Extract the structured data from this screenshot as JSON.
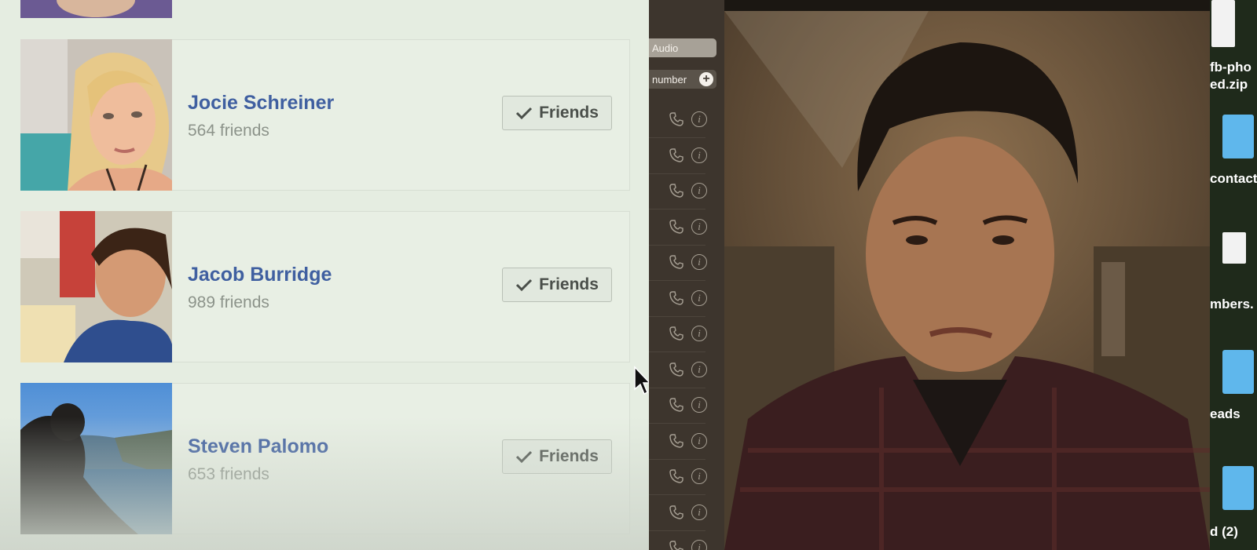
{
  "friends": [
    {
      "name": "Jocie Schreiner",
      "count": "564 friends",
      "button": "Friends"
    },
    {
      "name": "Jacob Burridge",
      "count": "989 friends",
      "button": "Friends"
    },
    {
      "name": "Steven Palomo",
      "count": "653 friends",
      "button": "Friends"
    }
  ],
  "call_panel": {
    "audio_label": "Audio",
    "number_label": "number",
    "plus_symbol": "+"
  },
  "desktop": {
    "labels": [
      "fb-pho",
      "ed.zip",
      "contact",
      "mbers.",
      "eads",
      "d (2)"
    ]
  },
  "colors": {
    "name_link": "#3f5fa0",
    "folder": "#5fb7ec"
  },
  "icons": [
    "check-icon",
    "phone-icon",
    "info-icon",
    "plus-icon",
    "cursor-icon",
    "folder-icon",
    "document-icon"
  ]
}
